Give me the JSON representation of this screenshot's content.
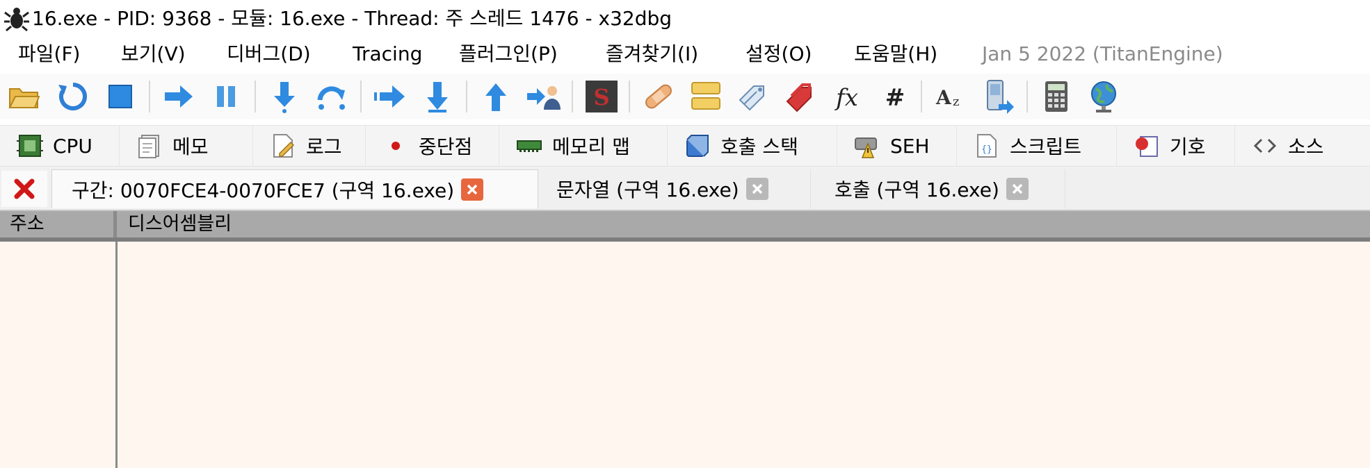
{
  "window": {
    "title": "16.exe - PID: 9368 - 모듈: 16.exe - Thread: 주 스레드 1476 - x32dbg",
    "icon": "bug-icon"
  },
  "menubar": {
    "items": [
      {
        "label": "파일(F)",
        "icon": ""
      },
      {
        "label": "보기(V)"
      },
      {
        "label": "디버그(D)"
      },
      {
        "label": "Tracing"
      },
      {
        "label": "플러그인(P)"
      },
      {
        "label": "즐겨찾기(I)"
      },
      {
        "label": "설정(O)"
      },
      {
        "label": "도움말(H)"
      }
    ],
    "build_info": "Jan 5 2022 (TitanEngine)"
  },
  "toolbar": {
    "buttons": [
      "open-icon",
      "restart-icon",
      "stop-icon",
      "run-icon",
      "pause-icon",
      "step-into-icon",
      "step-over-icon",
      "trace-into-icon",
      "trace-over-icon",
      "execute-till-return-icon",
      "run-to-user-code-icon",
      "scylla-icon",
      "patch-icon",
      "comment-icon",
      "label-icon",
      "bookmark-icon",
      "function-icon",
      "hash-icon",
      "strings-icon",
      "device-icon",
      "calculator-icon",
      "globe-icon"
    ]
  },
  "view_tabs": [
    {
      "label": "CPU",
      "icon": "cpu-icon"
    },
    {
      "label": "메모",
      "icon": "notes-icon"
    },
    {
      "label": "로그",
      "icon": "log-icon"
    },
    {
      "label": "중단점",
      "icon": "breakpoint-icon"
    },
    {
      "label": "메모리 맵",
      "icon": "memory-map-icon"
    },
    {
      "label": "호출 스택",
      "icon": "call-stack-icon"
    },
    {
      "label": "SEH",
      "icon": "seh-icon"
    },
    {
      "label": "스크립트",
      "icon": "script-icon"
    },
    {
      "label": "기호",
      "icon": "symbols-icon"
    },
    {
      "label": "소스",
      "icon": "source-icon"
    }
  ],
  "doc_tabs": [
    {
      "label": "구간: 0070FCE4-0070FCE7 (구역 16.exe)",
      "active": true
    },
    {
      "label": "문자열 (구역 16.exe)",
      "active": false
    },
    {
      "label": "호출 (구역 16.exe)",
      "active": false
    }
  ],
  "table": {
    "columns": [
      "주소",
      "디스어셈블리"
    ],
    "rows": []
  },
  "colors": {
    "table_bg": "#fff6f0",
    "header_bg": "#a9a9a9",
    "active_close": "#e8663d"
  }
}
